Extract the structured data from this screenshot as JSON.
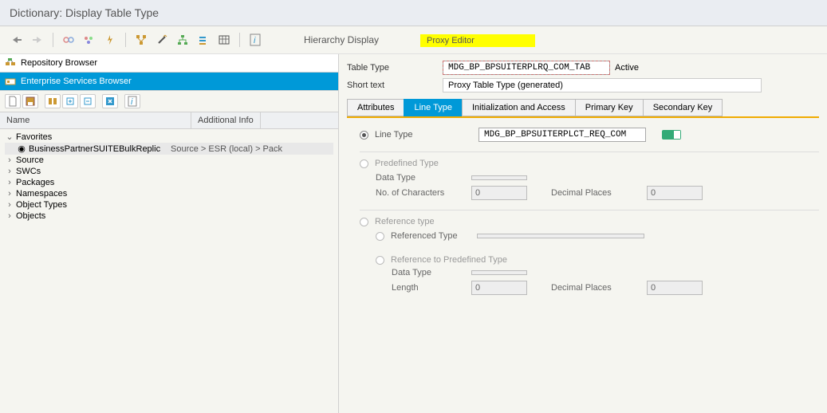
{
  "title": "Dictionary: Display Table Type",
  "toolbar_links": {
    "hierarchy": "Hierarchy Display",
    "proxy": "Proxy Editor"
  },
  "browsers": {
    "repo": "Repository Browser",
    "esb": "Enterprise Services Browser"
  },
  "tree_headers": {
    "name": "Name",
    "addl": "Additional Info"
  },
  "tree": {
    "favorites": "Favorites",
    "bp": "BusinessPartnerSUITEBulkReplic",
    "bp_addl": "Source > ESR (local) > Pack",
    "source": "Source",
    "swcs": "SWCs",
    "packages": "Packages",
    "namespaces": "Namespaces",
    "object_types": "Object Types",
    "objects": "Objects"
  },
  "fields": {
    "table_type_label": "Table Type",
    "table_type_value": "MDG_BP_BPSUITERPLRQ_COM_TAB",
    "active": "Active",
    "short_text_label": "Short text",
    "short_text_value": "Proxy Table Type (generated)"
  },
  "tabs": {
    "attributes": "Attributes",
    "line_type": "Line Type",
    "init_access": "Initialization and Access",
    "primary_key": "Primary Key",
    "secondary_key": "Secondary Key"
  },
  "line_type": {
    "radio_label": "Line Type",
    "value": "MDG_BP_BPSUITERPLCT_REQ_COM"
  },
  "predefined": {
    "radio_label": "Predefined Type",
    "data_type": "Data Type",
    "no_chars": "No. of Characters",
    "no_chars_val": "0",
    "decimals": "Decimal Places",
    "decimals_val": "0"
  },
  "reference": {
    "radio_label": "Reference type",
    "ref_type_label": "Referenced Type"
  },
  "ref_predef": {
    "radio_label": "Reference to Predefined Type",
    "data_type": "Data Type",
    "length": "Length",
    "length_val": "0",
    "decimals": "Decimal Places",
    "decimals_val": "0"
  }
}
